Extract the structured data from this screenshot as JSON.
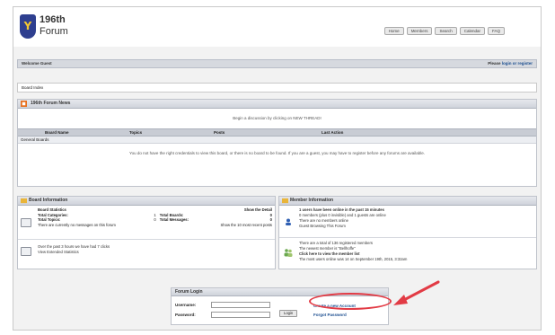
{
  "header": {
    "title_line1": "196th",
    "title_line2": "Forum",
    "nav": [
      "Home",
      "Members",
      "Search",
      "Calendar",
      "FAQ"
    ]
  },
  "welcome_bar": {
    "left": "Welcome Guest",
    "right_prefix": "Please",
    "right_link": "login or register"
  },
  "breadcrumb": "Board Index",
  "news": {
    "title": "196th Forum News",
    "message": "Begin a discussion by clicking on NEW THREAD!",
    "columns": [
      "Board Name",
      "Topics",
      "Posts",
      "Last Action"
    ],
    "subheader": "General Boards",
    "notice": "You do not have the right credentials to view this board, or there is no board to be found. If you are a guest, you may have to register before any forums are available."
  },
  "board_info": {
    "title": "Board Information",
    "stats_head_left": "Board Statistics",
    "stats_head_right": "Show the Detail",
    "stats": [
      {
        "label": "Total Categories:",
        "value": "1",
        "label2": "Total Boards:",
        "value2": "0"
      },
      {
        "label": "Total Topics:",
        "value": "0",
        "label2": "Total Messages:",
        "value2": "0"
      }
    ],
    "stats_note_left": "There are currently no messages on this forum",
    "stats_note_right": "Show the 10 most recent posts",
    "visits_line": "Over the past 3 hours we have had 7 clicks",
    "extended_link": "View Extended Statistics"
  },
  "member_info": {
    "title": "Member Information",
    "users_head": "1 users have been online in the past 15 minutes",
    "online_line": "0 members (plus 0 invisible) and 1 guests are online",
    "no_members": "There are no members online",
    "guest_line": "Guest Browsing This Forum",
    "total_members": "There are a total of 136 registered members",
    "newest_member": "The newest member is \"Bellhoffe\"",
    "member_list": "Click here to view the member list",
    "most_online": "The most users online was 14 on September 19th, 2015, 3:32am"
  },
  "login": {
    "title": "Forum Login",
    "username_label": "Username:",
    "password_label": "Password:",
    "button": "Login",
    "create_link": "Create a new Account",
    "forgot_link": "Forgot Password"
  },
  "annotation_color": "#e23b45"
}
